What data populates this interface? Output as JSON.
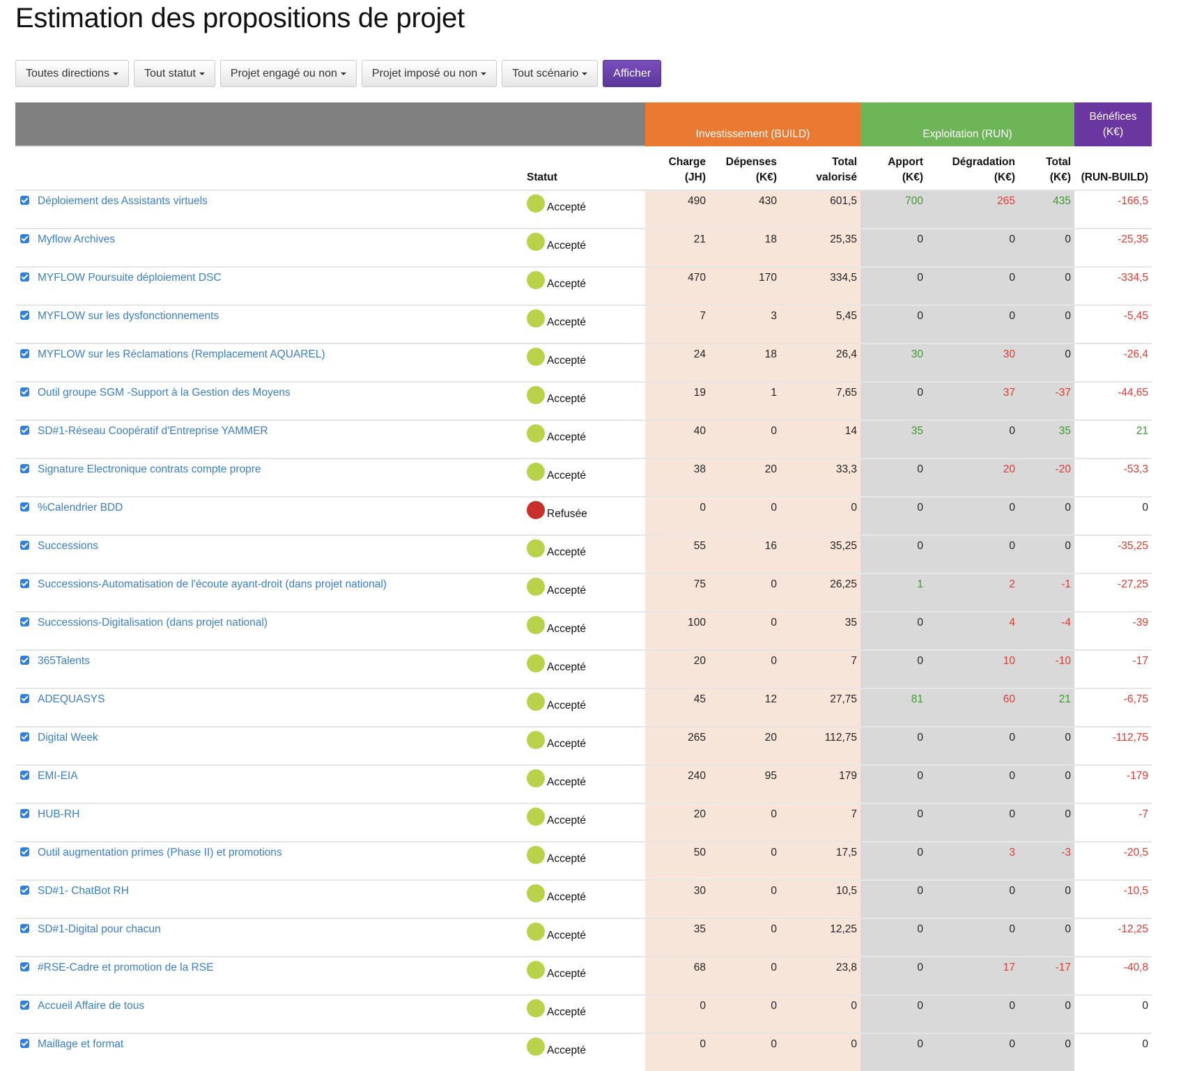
{
  "title": "Estimation des propositions de projet",
  "colors": {
    "accepted": "#b8d34a",
    "refused": "#c8302c",
    "build_header": "#ea7a32",
    "run_header": "#6db556",
    "benef_header": "#6a36a0",
    "positive": "#3c9a2b",
    "negative": "#e23a2e",
    "link": "#3b7fc9"
  },
  "filters": [
    {
      "label": "Toutes directions",
      "icon": "caret-down-icon"
    },
    {
      "label": "Tout statut",
      "icon": "caret-down-icon"
    },
    {
      "label": "Projet engagé ou non",
      "icon": "caret-down-icon"
    },
    {
      "label": "Projet imposé ou non",
      "icon": "caret-down-icon"
    },
    {
      "label": "Tout scénario",
      "icon": "caret-down-icon"
    }
  ],
  "show_button": "Afficher",
  "table": {
    "groups": {
      "build": "Investissement (BUILD)",
      "run": "Exploitation (RUN)",
      "benef_line1": "Bénéfices",
      "benef_line2": "(K€)"
    },
    "columns": {
      "status": "Statut",
      "charge": [
        "Charge",
        "(JH)"
      ],
      "depenses": [
        "Dépenses",
        "(K€)"
      ],
      "total_valorise": [
        "Total",
        "valorisé"
      ],
      "apport": [
        "Apport",
        "(K€)"
      ],
      "degradation": [
        "Dégradation",
        "(K€)"
      ],
      "total_run": [
        "Total",
        "(K€)"
      ],
      "benefices": "(RUN-BUILD)"
    },
    "rows": [
      {
        "name": "Déploiement des Assistants virtuels",
        "checked": true,
        "status": "Accepté",
        "charge": "490",
        "depenses": "430",
        "total_valorise": "601,5",
        "apport": "700",
        "degradation": "265",
        "total_run": "435",
        "benefices": "-166,5"
      },
      {
        "name": "Myflow Archives",
        "checked": true,
        "status": "Accepté",
        "charge": "21",
        "depenses": "18",
        "total_valorise": "25,35",
        "apport": "0",
        "degradation": "0",
        "total_run": "0",
        "benefices": "-25,35"
      },
      {
        "name": "MYFLOW Poursuite déploiement DSC",
        "checked": true,
        "status": "Accepté",
        "charge": "470",
        "depenses": "170",
        "total_valorise": "334,5",
        "apport": "0",
        "degradation": "0",
        "total_run": "0",
        "benefices": "-334,5"
      },
      {
        "name": "MYFLOW sur les dysfonctionnements",
        "checked": true,
        "status": "Accepté",
        "charge": "7",
        "depenses": "3",
        "total_valorise": "5,45",
        "apport": "0",
        "degradation": "0",
        "total_run": "0",
        "benefices": "-5,45"
      },
      {
        "name": "MYFLOW sur les Réclamations (Remplacement AQUAREL)",
        "checked": true,
        "status": "Accepté",
        "charge": "24",
        "depenses": "18",
        "total_valorise": "26,4",
        "apport": "30",
        "degradation": "30",
        "total_run": "0",
        "benefices": "-26,4"
      },
      {
        "name": "Outil groupe SGM -Support à la Gestion des Moyens",
        "checked": true,
        "status": "Accepté",
        "charge": "19",
        "depenses": "1",
        "total_valorise": "7,65",
        "apport": "0",
        "degradation": "37",
        "total_run": "-37",
        "benefices": "-44,65"
      },
      {
        "name": "SD#1-Réseau Coopératif d'Entreprise YAMMER",
        "checked": true,
        "status": "Accepté",
        "charge": "40",
        "depenses": "0",
        "total_valorise": "14",
        "apport": "35",
        "degradation": "0",
        "total_run": "35",
        "benefices": "21"
      },
      {
        "name": "Signature Electronique contrats compte propre",
        "checked": true,
        "status": "Accepté",
        "charge": "38",
        "depenses": "20",
        "total_valorise": "33,3",
        "apport": "0",
        "degradation": "20",
        "total_run": "-20",
        "benefices": "-53,3"
      },
      {
        "name": "%Calendrier BDD",
        "checked": true,
        "status": "Refusée",
        "charge": "0",
        "depenses": "0",
        "total_valorise": "0",
        "apport": "0",
        "degradation": "0",
        "total_run": "0",
        "benefices": "0"
      },
      {
        "name": "Successions",
        "checked": true,
        "status": "Accepté",
        "charge": "55",
        "depenses": "16",
        "total_valorise": "35,25",
        "apport": "0",
        "degradation": "0",
        "total_run": "0",
        "benefices": "-35,25"
      },
      {
        "name": "Successions-Automatisation de l'écoute ayant-droit (dans projet national)",
        "checked": true,
        "status": "Accepté",
        "charge": "75",
        "depenses": "0",
        "total_valorise": "26,25",
        "apport": "1",
        "degradation": "2",
        "total_run": "-1",
        "benefices": "-27,25"
      },
      {
        "name": "Successions-Digitalisation (dans projet national)",
        "checked": true,
        "status": "Accepté",
        "charge": "100",
        "depenses": "0",
        "total_valorise": "35",
        "apport": "0",
        "degradation": "4",
        "total_run": "-4",
        "benefices": "-39"
      },
      {
        "name": "365Talents",
        "checked": true,
        "status": "Accepté",
        "charge": "20",
        "depenses": "0",
        "total_valorise": "7",
        "apport": "0",
        "degradation": "10",
        "total_run": "-10",
        "benefices": "-17"
      },
      {
        "name": "ADEQUASYS",
        "checked": true,
        "status": "Accepté",
        "charge": "45",
        "depenses": "12",
        "total_valorise": "27,75",
        "apport": "81",
        "degradation": "60",
        "total_run": "21",
        "benefices": "-6,75"
      },
      {
        "name": "Digital Week",
        "checked": true,
        "status": "Accepté",
        "charge": "265",
        "depenses": "20",
        "total_valorise": "112,75",
        "apport": "0",
        "degradation": "0",
        "total_run": "0",
        "benefices": "-112,75"
      },
      {
        "name": "EMI-EIA",
        "checked": true,
        "status": "Accepté",
        "charge": "240",
        "depenses": "95",
        "total_valorise": "179",
        "apport": "0",
        "degradation": "0",
        "total_run": "0",
        "benefices": "-179"
      },
      {
        "name": "HUB-RH",
        "checked": true,
        "status": "Accepté",
        "charge": "20",
        "depenses": "0",
        "total_valorise": "7",
        "apport": "0",
        "degradation": "0",
        "total_run": "0",
        "benefices": "-7"
      },
      {
        "name": "Outil augmentation primes (Phase II) et promotions",
        "checked": true,
        "status": "Accepté",
        "charge": "50",
        "depenses": "0",
        "total_valorise": "17,5",
        "apport": "0",
        "degradation": "3",
        "total_run": "-3",
        "benefices": "-20,5"
      },
      {
        "name": "SD#1- ChatBot RH",
        "checked": true,
        "status": "Accepté",
        "charge": "30",
        "depenses": "0",
        "total_valorise": "10,5",
        "apport": "0",
        "degradation": "0",
        "total_run": "0",
        "benefices": "-10,5"
      },
      {
        "name": "SD#1-Digital pour chacun",
        "checked": true,
        "status": "Accepté",
        "charge": "35",
        "depenses": "0",
        "total_valorise": "12,25",
        "apport": "0",
        "degradation": "0",
        "total_run": "0",
        "benefices": "-12,25"
      },
      {
        "name": "#RSE-Cadre et promotion de la RSE",
        "checked": true,
        "status": "Accepté",
        "charge": "68",
        "depenses": "0",
        "total_valorise": "23,8",
        "apport": "0",
        "degradation": "17",
        "total_run": "-17",
        "benefices": "-40,8"
      },
      {
        "name": "Accueil Affaire de tous",
        "checked": true,
        "status": "Accepté",
        "charge": "0",
        "depenses": "0",
        "total_valorise": "0",
        "apport": "0",
        "degradation": "0",
        "total_run": "0",
        "benefices": "0"
      },
      {
        "name": "Maillage et format",
        "checked": true,
        "status": "Accepté",
        "charge": "0",
        "depenses": "0",
        "total_valorise": "0",
        "apport": "0",
        "degradation": "0",
        "total_run": "0",
        "benefices": "0"
      }
    ]
  }
}
